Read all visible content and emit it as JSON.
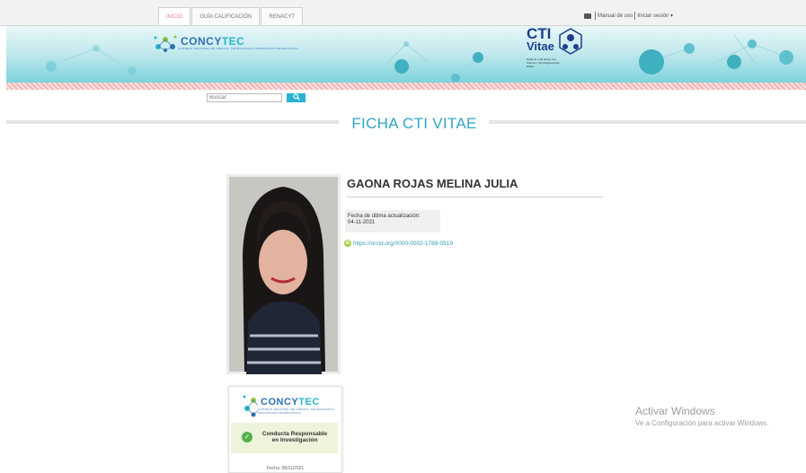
{
  "nav": {
    "tabs": [
      "INICIO",
      "GUÍA CALIFICACIÓN",
      "RENACYT"
    ],
    "manual_label": "Manual de uso",
    "login_label": "Iniciar sesión ▾"
  },
  "banner": {
    "concytec": {
      "name_part1": "CONCY",
      "name_part2": "TEC",
      "subtitle": "CONSEJO NACIONAL DE CIENCIA, TECNOLOGÍA E INNOVACIÓN TECNOLÓGICA"
    },
    "vitae": {
      "cti": "CTI",
      "vitae": "Vitae",
      "subtitle": "Hojas de vida afines a la Ciencia y Tecnología (antes DINA)"
    }
  },
  "search": {
    "placeholder": "Buscar",
    "button_icon": "search-icon"
  },
  "page_title": "FICHA CTI VITAE",
  "profile": {
    "name": "GAONA ROJAS MELINA JULIA",
    "updated_label": "Fecha de última actualización:",
    "updated_date": "04-11-2021",
    "orcid_url": "https://orcid.org/0000-0002-1789-0519",
    "orcid_icon": "iD"
  },
  "badge": {
    "logo_part1": "CONCY",
    "logo_part2": "TEC",
    "logo_sub": "CONSEJO NACIONAL DE CIENCIA, TECNOLOGÍA E INNOVACIÓN TECNOLÓGICA",
    "conduct_line1": "Conducta Responsable",
    "conduct_line2": "en Investigación",
    "date": "Fecha: 08/11/2021"
  },
  "watermark": {
    "title": "Activar Windows",
    "subtitle": "Ve a Configuración para activar Windows."
  },
  "colors": {
    "accent": "#2fa6c4",
    "search_button": "#27b4d0",
    "badge_check": "#53b24b",
    "orcid": "#a6ce39"
  }
}
